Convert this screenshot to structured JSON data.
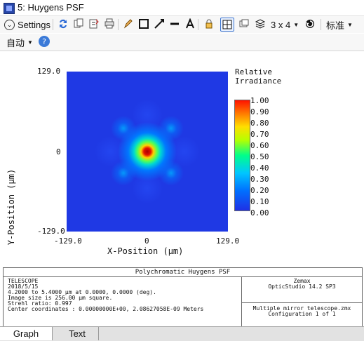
{
  "window": {
    "title": "5: Huygens PSF",
    "app_icon": "zemax-window-icon"
  },
  "toolbar": {
    "settings_label": "Settings",
    "layout_label": "3 x 4",
    "standard_label": "标准",
    "auto_label": "自动",
    "icons": [
      "refresh-icon",
      "copy-icon",
      "export-icon",
      "print-icon",
      "pencil-icon",
      "rectangle-icon",
      "arrow-icon",
      "line-icon",
      "text-icon",
      "lock-icon",
      "grid-icon",
      "window-copy-icon",
      "stack-icon",
      "rotate-icon",
      "help-icon"
    ]
  },
  "plot": {
    "y_label": "Y-Position (μm)",
    "x_label": "X-Position (μm)",
    "colorbar_title_line1": "Relative",
    "colorbar_title_line2": "Irradiance",
    "y_ticks": [
      "129.0",
      "0",
      "-129.0"
    ],
    "x_ticks": [
      "-129.0",
      "0",
      "129.0"
    ],
    "colorbar_ticks": [
      "1.00",
      "0.90",
      "0.80",
      "0.70",
      "0.60",
      "0.50",
      "0.40",
      "0.30",
      "0.20",
      "0.10",
      "0.00"
    ],
    "heatmap_colors": {
      "low": "#1f39e4",
      "mid": "#54ff54",
      "high": "#e41400",
      "peak": "#a80000"
    }
  },
  "info": {
    "panel_title": "Polychromatic Huygens PSF",
    "left_lines": [
      "TELESCOPE",
      "2018/5/15",
      "4.2000 to 5.4000 μm at 0.0000, 0.0000 (deg).",
      "Image size is 256.00 μm square.",
      "Strehl ratio: 0.997",
      "Center coordinates  :     0.00000000E+00,    2.08627058E-09 Meters"
    ],
    "right_top_lines": [
      "Zemax",
      "OpticStudio 14.2 SP3"
    ],
    "right_bottom_lines": [
      "Multiple mirror telescope.zmx",
      "Configuration 1 of 1"
    ]
  },
  "tabs": [
    "Graph",
    "Text"
  ]
}
